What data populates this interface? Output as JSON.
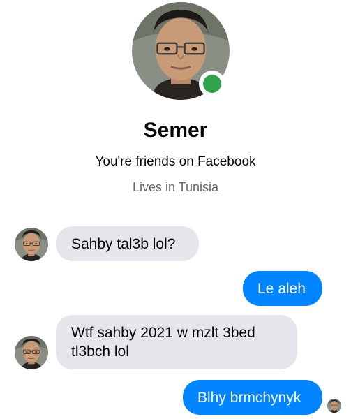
{
  "contact": {
    "name": "Semer",
    "friends_text": "You're friends on Facebook",
    "lives_text": "Lives in Tunisia",
    "online": true
  },
  "messages": [
    {
      "sender": "contact",
      "text": "Sahby tal3b lol?"
    },
    {
      "sender": "me",
      "text": "Le aleh"
    },
    {
      "sender": "contact",
      "text": "Wtf sahby 2021 w mzlt 3bed tl3bch lol"
    },
    {
      "sender": "me",
      "text": "Blhy brmchynyk"
    }
  ],
  "colors": {
    "outgoing_bubble": "#0084ff",
    "incoming_bubble": "#e4e6eb",
    "online_indicator": "#31a24c",
    "secondary_text": "#65676b"
  }
}
